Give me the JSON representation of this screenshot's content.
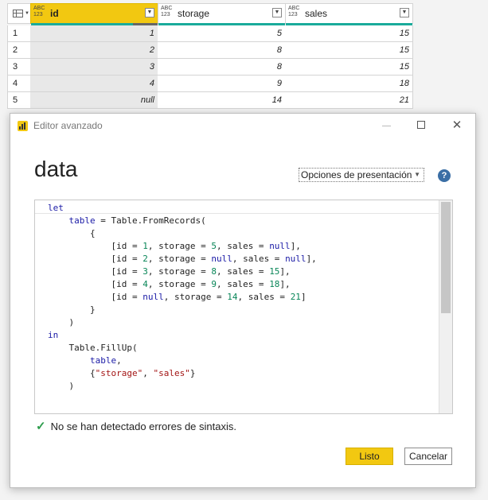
{
  "grid": {
    "columns": [
      {
        "type_label_top": "ABC",
        "type_label_bottom": "123",
        "name": "id"
      },
      {
        "type_label_top": "ABC",
        "type_label_bottom": "123",
        "name": "storage"
      },
      {
        "type_label_top": "ABC",
        "type_label_bottom": "123",
        "name": "sales"
      }
    ],
    "rows": [
      {
        "num": "1",
        "id": "1",
        "storage": "5",
        "sales": "15"
      },
      {
        "num": "2",
        "id": "2",
        "storage": "8",
        "sales": "15"
      },
      {
        "num": "3",
        "id": "3",
        "storage": "8",
        "sales": "15"
      },
      {
        "num": "4",
        "id": "4",
        "storage": "9",
        "sales": "18"
      },
      {
        "num": "5",
        "id": "null",
        "storage": "14",
        "sales": "21"
      }
    ]
  },
  "dialog": {
    "title": "Editor avanzado",
    "query_name": "data",
    "display_options": "Opciones de presentación",
    "help": "?",
    "status": "No se han detectado errores de sintaxis.",
    "ok_label": "Listo",
    "cancel_label": "Cancelar"
  },
  "code": [
    [
      {
        "t": "let",
        "c": "kw"
      }
    ],
    [
      {
        "t": "    "
      },
      {
        "t": "table",
        "c": "kw"
      },
      {
        "t": " = Table.FromRecords("
      }
    ],
    [
      {
        "t": "        {"
      }
    ],
    [
      {
        "t": "            [id = "
      },
      {
        "t": "1",
        "c": "num"
      },
      {
        "t": ", storage = "
      },
      {
        "t": "5",
        "c": "num"
      },
      {
        "t": ", sales = "
      },
      {
        "t": "null",
        "c": "kw"
      },
      {
        "t": "],"
      }
    ],
    [
      {
        "t": "            [id = "
      },
      {
        "t": "2",
        "c": "num"
      },
      {
        "t": ", storage = "
      },
      {
        "t": "null",
        "c": "kw"
      },
      {
        "t": ", sales = "
      },
      {
        "t": "null",
        "c": "kw"
      },
      {
        "t": "],"
      }
    ],
    [
      {
        "t": "            [id = "
      },
      {
        "t": "3",
        "c": "num"
      },
      {
        "t": ", storage = "
      },
      {
        "t": "8",
        "c": "num"
      },
      {
        "t": ", sales = "
      },
      {
        "t": "15",
        "c": "num"
      },
      {
        "t": "],"
      }
    ],
    [
      {
        "t": "            [id = "
      },
      {
        "t": "4",
        "c": "num"
      },
      {
        "t": ", storage = "
      },
      {
        "t": "9",
        "c": "num"
      },
      {
        "t": ", sales = "
      },
      {
        "t": "18",
        "c": "num"
      },
      {
        "t": "],"
      }
    ],
    [
      {
        "t": "            [id = "
      },
      {
        "t": "null",
        "c": "kw"
      },
      {
        "t": ", storage = "
      },
      {
        "t": "14",
        "c": "num"
      },
      {
        "t": ", sales = "
      },
      {
        "t": "21",
        "c": "num"
      },
      {
        "t": "]"
      }
    ],
    [
      {
        "t": "        }"
      }
    ],
    [
      {
        "t": "    )"
      }
    ],
    [
      {
        "t": "in",
        "c": "kw"
      }
    ],
    [
      {
        "t": "    Table.FillUp("
      }
    ],
    [
      {
        "t": "        "
      },
      {
        "t": "table",
        "c": "kw"
      },
      {
        "t": ","
      }
    ],
    [
      {
        "t": "        {"
      },
      {
        "t": "\"storage\"",
        "c": "str"
      },
      {
        "t": ", "
      },
      {
        "t": "\"sales\"",
        "c": "str"
      },
      {
        "t": "}"
      }
    ],
    [
      {
        "t": "    )"
      }
    ]
  ]
}
